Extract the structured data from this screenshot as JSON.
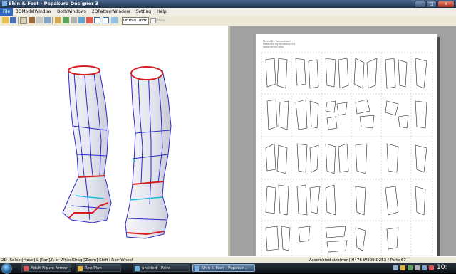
{
  "window": {
    "title": "Shin & Feet - Pepakura Designer 3",
    "min_symbol": "_",
    "max_symbol": "□",
    "close_symbol": "x"
  },
  "menu": [
    "File",
    "3DModelWindow",
    "BothWindows",
    "2DPatternWindow",
    "Setting",
    "Help"
  ],
  "toolbar": {
    "unfold_undo_label": "Unfold Undo",
    "auto_label": "Auto"
  },
  "pattern_page": {
    "credit_lines": [
      "Model By Vanquished",
      "Unfolded by Studious314",
      "www.405th.com"
    ]
  },
  "statusbar": {
    "left": "2D [Select|Move] L [Pan]/R or WheelDrag [Zoom] Shift+R or Wheel",
    "right": "Assembled size(mm) H476 W309 D253 / Parts 67"
  },
  "taskbar": {
    "items": [
      {
        "label": "Adult Figure Armor -",
        "icon": "browser-icon",
        "color": "#d9534f"
      },
      {
        "label": "Rep Plan",
        "icon": "folder-icon",
        "color": "#e3b341"
      },
      {
        "label": "untitled - Paint",
        "icon": "paint-icon",
        "color": "#6fb3e0"
      },
      {
        "label": "Shin & Feet - Pepakur...",
        "icon": "pepakura-icon",
        "color": "#7db0e8"
      }
    ],
    "clock": "10:"
  }
}
